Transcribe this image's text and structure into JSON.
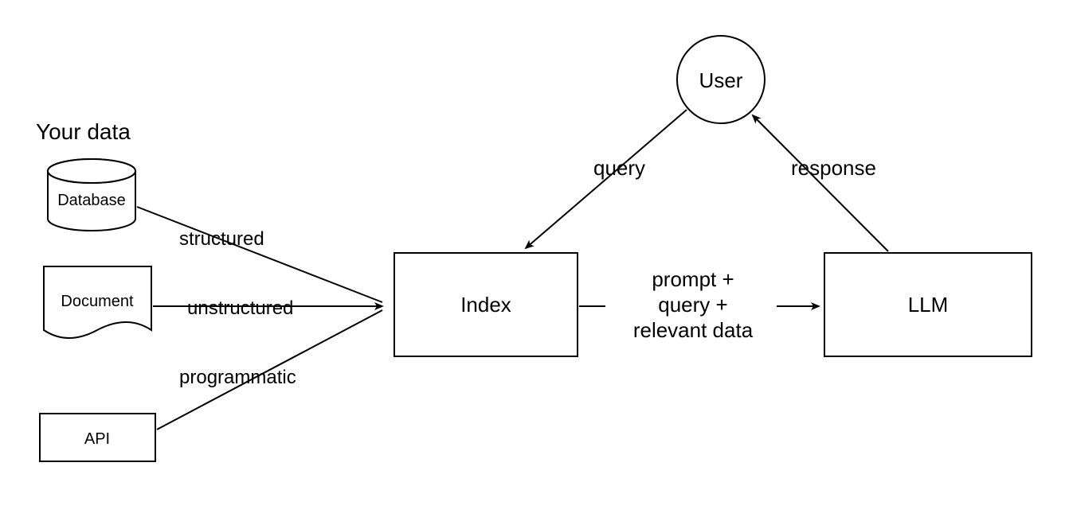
{
  "title": "Your data",
  "nodes": {
    "database": "Database",
    "document": "Document",
    "api": "API",
    "index": "Index",
    "llm": "LLM",
    "user": "User"
  },
  "edges": {
    "structured": "structured",
    "unstructured": "unstructured",
    "programmatic": "programmatic",
    "query": "query",
    "response": "response",
    "prompt_lines": [
      "prompt +",
      "query +",
      "relevant data"
    ]
  }
}
